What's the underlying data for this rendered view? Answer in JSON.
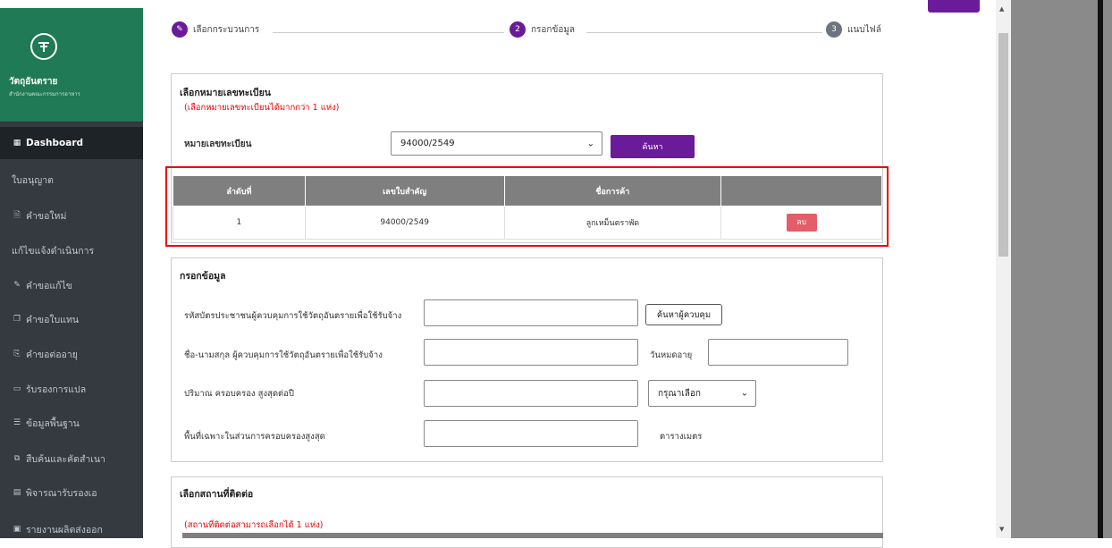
{
  "sidebar": {
    "brand_name": "วัตถุอันตราย",
    "brand_sub": "สำนักงานคณะกรรมการอาหาร",
    "items": [
      {
        "label": "Dashboard",
        "icon": "dashboard-icon",
        "active": true
      },
      {
        "label": "ใบอนุญาต",
        "icon": ""
      },
      {
        "label": "คำขอใหม่",
        "icon": "file-icon"
      },
      {
        "label": "แก้ไขแจ้งดำเนินการ",
        "icon": ""
      },
      {
        "label": "คำขอแก้ไข",
        "icon": "edit-icon"
      },
      {
        "label": "คำขอใบแทน",
        "icon": "copy-icon"
      },
      {
        "label": "คำขอต่ออายุ",
        "icon": "renew-icon"
      },
      {
        "label": "รับรองการแปล",
        "icon": "id-card-icon"
      },
      {
        "label": "ข้อมูลพื้นฐาน",
        "icon": "list-icon"
      },
      {
        "label": "สืบค้นและคัดสำเนา",
        "icon": "copy-outline-icon"
      },
      {
        "label": "พิจารณารับรองเอ",
        "icon": "book-icon"
      },
      {
        "label": "รายงานผลิตส่งออก",
        "icon": "report-icon"
      }
    ]
  },
  "steps": [
    {
      "num": "",
      "label": "เลือกกระบวนการ",
      "state": "done"
    },
    {
      "num": "2",
      "label": "กรอกข้อมูล",
      "state": "active"
    },
    {
      "num": "3",
      "label": "แนบไฟล์",
      "state": "pending"
    }
  ],
  "registration": {
    "title": "เลือกหมายเลขทะเบียน",
    "note": "(เลือกหมายเลขทะเบียนได้มากกว่า 1 แห่ง)",
    "field_label": "หมายเลขทะเบียน",
    "selected": "94000/2549",
    "search_button": "ค้นหา",
    "table": {
      "headers": [
        "ลำดับที่",
        "เลขใบสำคัญ",
        "ชื่อการค้า",
        ""
      ],
      "rows": [
        {
          "no": "1",
          "cert": "94000/2549",
          "trade": "ลูกเหม็นตราพัด",
          "action": "ลบ"
        }
      ]
    }
  },
  "form": {
    "title": "กรอกข้อมูล",
    "row1_label": "รหัสบัตรประชาชนผู้ควบคุมการใช้วัตถุอันตรายเพื่อใช้รับจ้าง",
    "row1_button": "ค้นหาผู้ควบคุม",
    "row2_label": "ชื่อ-นามสกุล ผู้ควบคุมการใช้วัตถุอันตรายเพื่อใช้รับจ้าง",
    "row2_label_right": "วันหมดอายุ",
    "row3_label": "ปริมาณ ครอบครอง สูงสุดต่อปี",
    "row3_select": "กรุณาเลือก",
    "row4_label": "พื้นที่เฉพาะในส่วนการครอบครองสูงสุด",
    "row4_unit": "ตารางเมตร"
  },
  "contact": {
    "title": "เลือกสถานที่ติดต่อ",
    "note": "(สถานที่ติดต่อสามารถเลือกได้ 1 แห่ง)"
  },
  "colors": {
    "brand_green": "#1f7a55",
    "purple": "#6a1b9a",
    "danger": "#e35d6a",
    "highlight": "#ee0000"
  }
}
